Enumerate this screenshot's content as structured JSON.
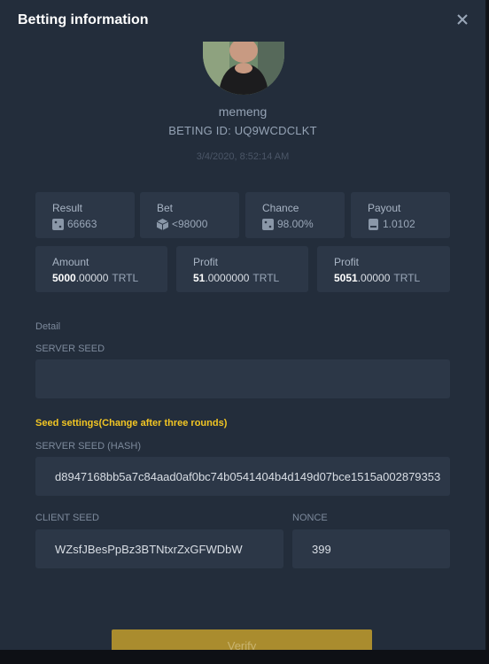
{
  "header": {
    "title": "Betting information"
  },
  "profile": {
    "username": "memeng",
    "bet_id": "BETING ID: UQ9WCDCLKT",
    "date": "3/4/2020, 8:52:14 AM"
  },
  "stats": [
    {
      "label": "Result",
      "value": "66663",
      "icon": "dice-icon"
    },
    {
      "label": "Bet",
      "value": "<98000",
      "icon": "cube-icon"
    },
    {
      "label": "Chance",
      "value": "98.00%",
      "icon": "dice-icon"
    },
    {
      "label": "Payout",
      "value": "1.0102",
      "icon": "payout-icon"
    }
  ],
  "amounts": [
    {
      "label": "Amount",
      "int": "5000",
      "dec": ".00000",
      "unit": "TRTL"
    },
    {
      "label": "Profit",
      "int": "51",
      "dec": ".0000000",
      "unit": "TRTL"
    },
    {
      "label": "Profit",
      "int": "5051",
      "dec": ".00000",
      "unit": "TRTL"
    }
  ],
  "detail": {
    "heading": "Detail",
    "server_seed_label": "SERVER SEED",
    "server_seed_value": ""
  },
  "seed_settings": {
    "heading": "Seed settings(Change after three rounds)",
    "server_seed_hash_label": "SERVER SEED (HASH)",
    "server_seed_hash": "d8947168bb5a7c84aad0af0bc74b0541404b4d149d07bce1515a002879353",
    "client_seed_label": "CLIENT SEED",
    "client_seed": "WZsfJBesPpBz3BTNtxrZxGFWDbW",
    "nonce_label": "NONCE",
    "nonce": "399"
  },
  "verify_label": "Verify",
  "colors": {
    "background": "#232d3b",
    "card": "#2c3747",
    "accent_yellow": "#f3c623",
    "button": "#aa8c2e"
  }
}
